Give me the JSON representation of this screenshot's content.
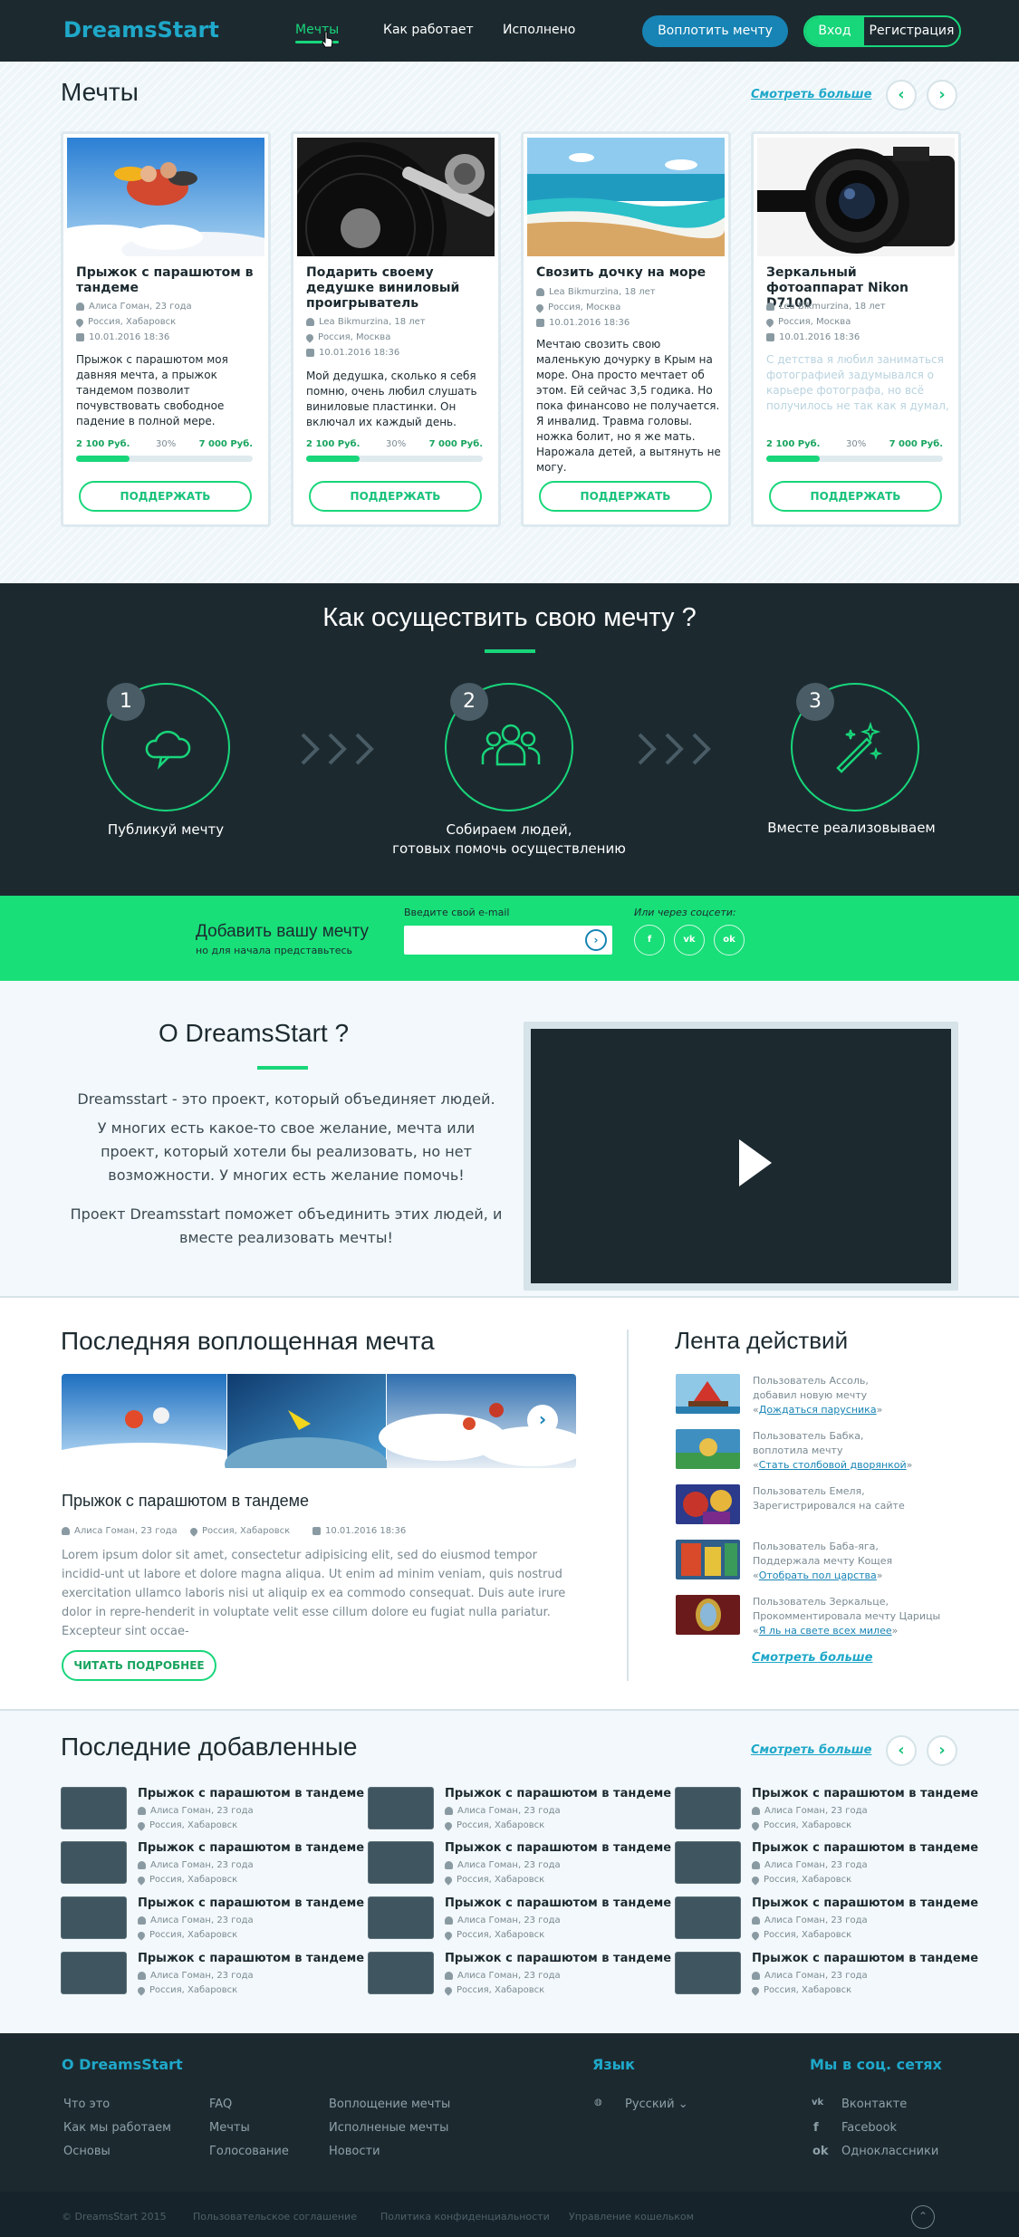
{
  "header": {
    "logo": "DreamsStart",
    "nav": [
      "Мечты",
      "Как работает",
      "Исполнено"
    ],
    "realize_button": "Воплотить мечту",
    "login": "Вход",
    "register": "Регистрация"
  },
  "dreams": {
    "title": "Мечты",
    "see_more": "Смотреть больше",
    "support_label": "ПОДДЕРЖАТЬ",
    "cards": [
      {
        "title": "Прыжок с парашютом в тандеме",
        "author": "Алиса Гоман, 23 года",
        "location": "Россия, Хабаровск",
        "date": "10.01.2016  18:36",
        "desc": "Прыжок с парашютом моя давняя мечта, а прыжок тандемом позволит почувствовать свободное падение в полной мере.",
        "collected": "2 100 Руб.",
        "percent": "30%",
        "goal": "7 000 Руб.",
        "progress": 0.3
      },
      {
        "title": "Подарить своему дедушке виниловый проигрыватель",
        "author": "Lea Bikmurzina, 18 лет",
        "location": "Россия, Москва",
        "date": "10.01.2016  18:36",
        "desc": "Мой дедушка, сколько я себя помню, очень любил слушать виниловые пластинки. Он включал их каждый день.",
        "collected": "2 100 Руб.",
        "percent": "30%",
        "goal": "7 000 Руб.",
        "progress": 0.3
      },
      {
        "title": "Свозить дочку на море",
        "author": "Lea Bikmurzina, 18 лет",
        "location": "Россия, Москва",
        "date": "10.01.2016  18:36",
        "desc": "Мечтаю свозить свою маленькую дочурку в Крым на море. Она просто мечтает об этом. Ей сейчас 3,5 годика. Но пока финансово не получается. Я инвалид. Травма головы. ножка болит, но я же мать. Нарожала детей, а вытянуть не могу."
      },
      {
        "title": "Зеркальный фотоаппарат Nikon D7100",
        "author": "Lea Bikmurzina, 18 лет",
        "location": "Россия, Москва",
        "date": "10.01.2016  18:36",
        "desc": "С детства я любил заниматься фотографией задумывался о карьере фотографа, но всё получилось не так как я думал, и пришлось забыть о мечте",
        "collected": "2 100 Руб.",
        "percent": "30%",
        "goal": "7 000 Руб.",
        "progress": 0.3
      }
    ]
  },
  "how": {
    "title": "Как осуществить свою мечту ?",
    "steps": [
      {
        "num": "1",
        "label": "Публикуй мечту",
        "icon": "cloud-chat-icon"
      },
      {
        "num": "2",
        "label_line1": "Собираем людей,",
        "label_line2": "готовых помочь осуществлению",
        "icon": "people-group-icon"
      },
      {
        "num": "3",
        "label": "Вместе реализовываем",
        "icon": "magic-wand-icon"
      }
    ]
  },
  "subscribe": {
    "title": "Добавить вашу мечту",
    "subtitle": "но для начала представьтесь",
    "email_label": "Введите свой e-mail",
    "email_value": "",
    "social_label": "Или через соцсети:",
    "socials": [
      "f",
      "vk",
      "ok"
    ]
  },
  "about": {
    "title": "О DreamsStart ?",
    "p1": "Dreamsstart - это проект, который объединяет людей.",
    "p2": "У многих есть какое-то свое желание, мечта или проект, который хотели бы реализовать, но нет возможности. У многих есть желание помочь!",
    "p3": "Проект Dreamsstart поможет объединить этих людей, и вместе реализовать мечты!"
  },
  "last": {
    "title": "Последняя воплощенная мечта",
    "item_title": "Прыжок с парашютом в тандеме",
    "author": "Алиса Гоман, 23 года",
    "location": "Россия, Хабаровск",
    "date": "10.01.2016  18:36",
    "lorem": "Lorem ipsum dolor sit amet, consectetur adipisicing elit, sed do eiusmod tempor incidid-unt ut labore et dolore magna aliqua. Ut enim ad minim veniam, quis nostrud exercitation ullamco laboris nisi ut aliquip ex ea commodo consequat. Duis aute irure dolor in repre-henderit in voluptate velit esse cillum dolore eu fugiat nulla pariatur. Excepteur sint occae-",
    "read_more": "ЧИТАТЬ ПОДРОБНЕЕ"
  },
  "feed": {
    "title": "Лента действий",
    "see_more": "Смотреть больше",
    "items": [
      {
        "l1": "Пользователь  Ассоль,",
        "l2": "добавил новую мечту",
        "link": "Дождаться парусника"
      },
      {
        "l1": "Пользователь  Бабка,",
        "l2": "воплотила мечту",
        "link": "Стать столбовой дворянкой"
      },
      {
        "l1": "Пользователь  Емеля,",
        "l2": "Зарегистрировался на сайте",
        "link": ""
      },
      {
        "l1": "Пользователь  Баба-яга,",
        "l2": "Поддержала мечту  Кощея",
        "link": "Отобрать пол царства"
      },
      {
        "l1": "Пользователь  Зеркальце,",
        "l2": "Прокомментировала мечту  Царицы",
        "link": "Я ль на свете всех милее"
      }
    ]
  },
  "recent": {
    "title": "Последние добавленные",
    "see_more": "Смотреть больше",
    "item_title": "Прыжок с парашютом в тандеме",
    "author": "Алиса Гоман, 23 года",
    "location": "Россия, Хабаровск"
  },
  "footer": {
    "about_title": "О DreamsStart",
    "col1": [
      "Что это",
      "Как мы работаем",
      "Основы"
    ],
    "col2": [
      "FAQ",
      "Мечты",
      "Голосование"
    ],
    "col3": [
      "Воплощение мечты",
      "Исполненые мечты",
      "Новости"
    ],
    "lang_title": "Язык",
    "lang_value": "Русский",
    "social_title": "Мы в соц. сетях",
    "socials": [
      "Вконтакте",
      "Facebook",
      "Одноклассники"
    ],
    "copyright": "© DreamsStart  2015",
    "links": [
      "Пользовательское соглашение",
      "Политика конфиденциальности",
      "Управление кошельком"
    ]
  }
}
